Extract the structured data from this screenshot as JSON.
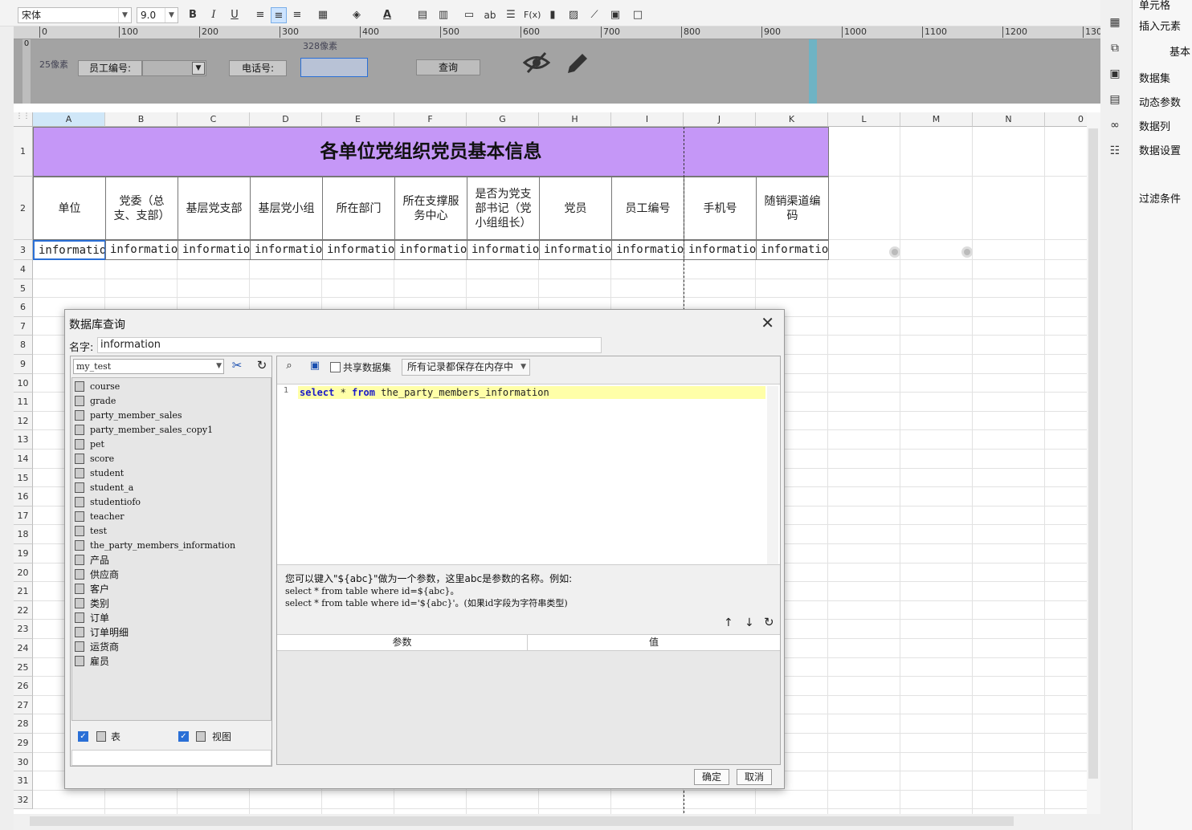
{
  "toolbar": {
    "font_name": "宋体",
    "font_size": "9.0",
    "buttons": [
      "B",
      "I",
      "U",
      "ab",
      "F(x)"
    ]
  },
  "ruler": {
    "ticks": [
      "0",
      "100",
      "200",
      "300",
      "400",
      "500",
      "600",
      "700",
      "800",
      "900",
      "1000",
      "1100",
      "1200",
      "130"
    ],
    "side_label": "0"
  },
  "param_area": {
    "height_label": "25像素",
    "width_label": "328像素",
    "employee_label": "员工编号:",
    "phone_label": "电话号:",
    "query_button": "查询"
  },
  "sheet": {
    "columns": [
      "A",
      "B",
      "C",
      "D",
      "E",
      "F",
      "G",
      "H",
      "I",
      "J",
      "K",
      "L",
      "M",
      "N",
      "0"
    ],
    "rows": [
      "1",
      "2",
      "3",
      "4",
      "5",
      "6",
      "7",
      "8",
      "9",
      "10",
      "11",
      "12",
      "13",
      "14",
      "15",
      "16",
      "17",
      "18",
      "19",
      "20",
      "21",
      "22",
      "23",
      "24",
      "25",
      "26",
      "27",
      "28",
      "29",
      "30",
      "31",
      "32"
    ],
    "title": "各单位党组织党员基本信息",
    "headers": [
      "单位",
      "党委（总支、支部）",
      "基层党支部",
      "基层党小组",
      "所在部门",
      "所在支撑服务中心",
      "是否为党支部书记（党小组组长）",
      "党员",
      "员工编号",
      "手机号",
      "随销渠道编码"
    ],
    "data_row": [
      "informatio",
      "informatio",
      "informatio",
      "informatio",
      "informatio",
      "informatio",
      "informatio",
      "informatio",
      "informatio",
      "informatio",
      "informatio"
    ]
  },
  "right_panel": {
    "items": [
      "单元格",
      "插入元素",
      "基本",
      "数据集",
      "动态参数",
      "数据列",
      "数据设置",
      "过滤条件"
    ]
  },
  "dialog": {
    "title": "数据库查询",
    "name_label": "名字:",
    "name_value": "information",
    "database": "my_test",
    "tables": [
      "course",
      "grade",
      "party_member_sales",
      "party_member_sales_copy1",
      "pet",
      "score",
      "student",
      "student_a",
      "studentiofo",
      "teacher",
      "test",
      "the_party_members_information",
      "产品",
      "供应商",
      "客户",
      "类别",
      "订单",
      "订单明细",
      "运货商",
      "雇员"
    ],
    "show_table_label": "表",
    "show_view_label": "视图",
    "shared_dataset_label": "共享数据集",
    "storage_mode": "所有记录都保存在内存中",
    "sql": {
      "line_number": "1",
      "kw_select": "select",
      "star": " * ",
      "kw_from": "from",
      "table": " the_party_members_information"
    },
    "hint_line1": "您可以键入\"${abc}\"做为一个参数，这里abc是参数的名称。例如:",
    "hint_line2": "select * from table where id=${abc}。",
    "hint_line3": "select * from table where id='${abc}'。(如果id字段为字符串类型)",
    "param_col": "参数",
    "value_col": "值",
    "ok_button": "确定",
    "cancel_button": "取消"
  }
}
